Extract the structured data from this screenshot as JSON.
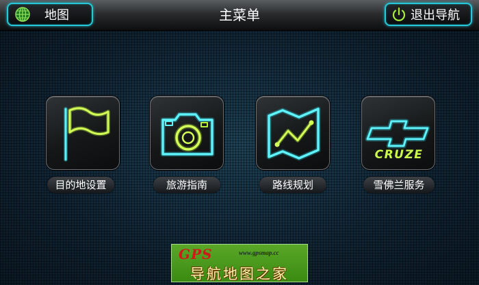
{
  "header": {
    "title": "主菜单",
    "map_button": {
      "label": "地图",
      "icon": "globe-icon"
    },
    "exit_button": {
      "label": "退出导航",
      "icon": "power-icon"
    }
  },
  "menu": {
    "items": [
      {
        "label": "目的地设置",
        "icon": "flag-icon"
      },
      {
        "label": "旅游指南",
        "icon": "camera-icon"
      },
      {
        "label": "路线规划",
        "icon": "route-map-icon"
      },
      {
        "label": "雪佛兰服务",
        "icon": "chevrolet-bowtie-icon",
        "icon_text": "CRUZE"
      }
    ]
  },
  "watermark": {
    "brand": "GPS",
    "url": "www.gpsmap.cc",
    "chinese": "导航地图之家"
  },
  "colors": {
    "cyan_glow": "#3ee6f0",
    "green_glow": "#b8f23a"
  }
}
